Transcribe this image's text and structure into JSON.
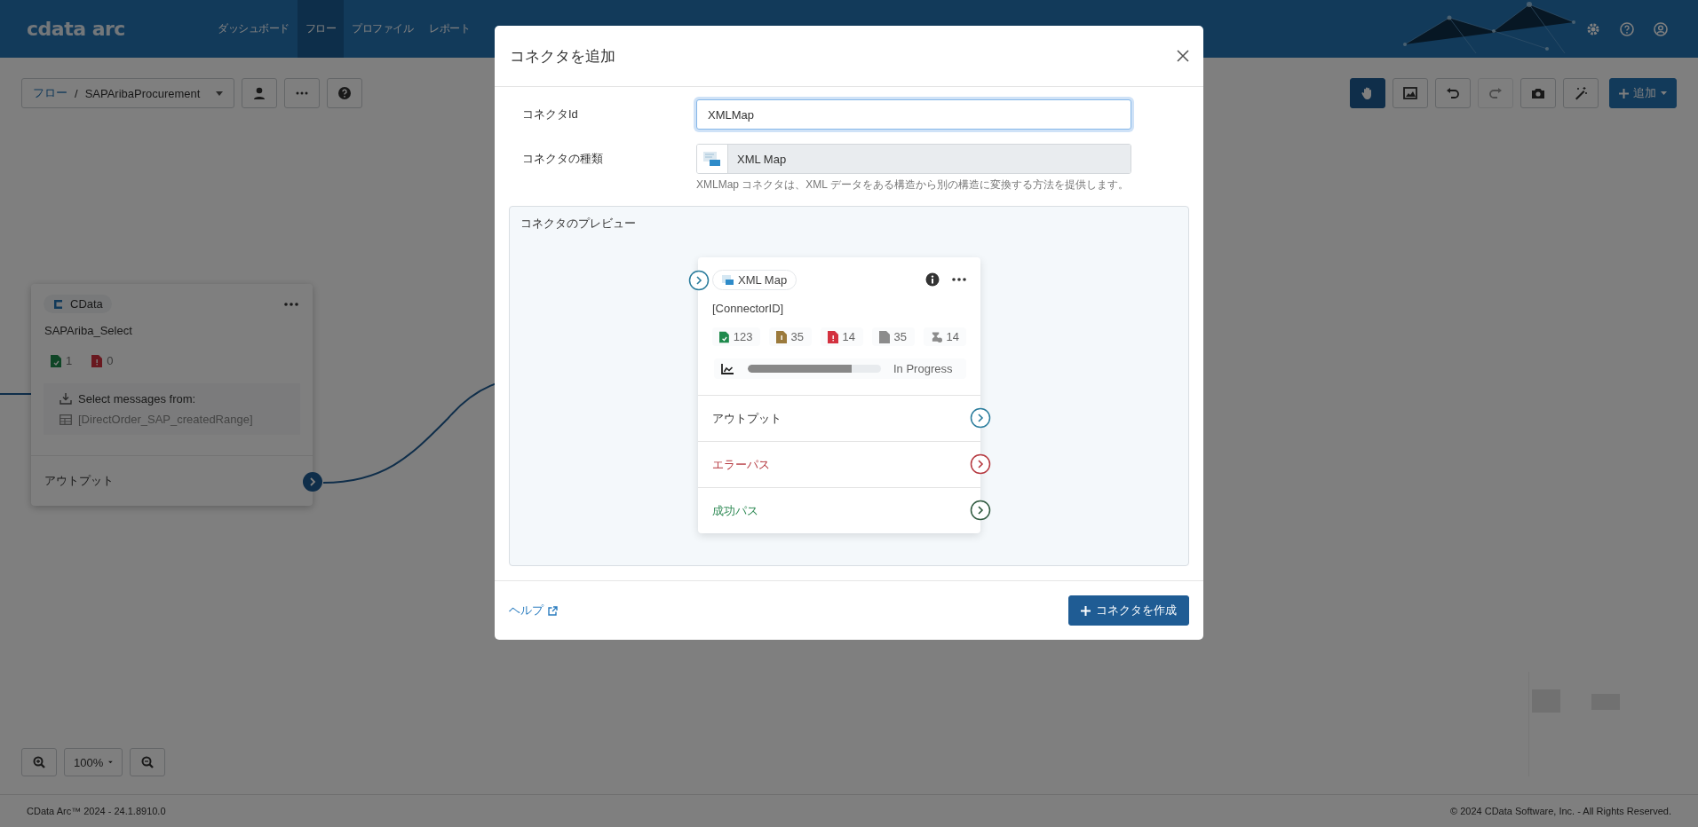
{
  "navbar": {
    "logo": "cdata arc",
    "nav_items": [
      {
        "label": "ダッシュボード",
        "selected": false
      },
      {
        "label": "フロー",
        "selected": true
      },
      {
        "label": "プロファイル",
        "selected": false
      },
      {
        "label": "レポート",
        "selected": false
      }
    ]
  },
  "toolbar": {
    "breadcrumb_root": "フロー",
    "breadcrumb_separator": "/",
    "breadcrumb_flow": "SAPAribaProcurement",
    "tools": [
      {
        "kind": "hand",
        "selected": true,
        "disabled": false
      },
      {
        "kind": "image",
        "selected": false,
        "disabled": false
      },
      {
        "kind": "undo",
        "selected": false,
        "disabled": false
      },
      {
        "kind": "redo",
        "selected": false,
        "disabled": true
      },
      {
        "kind": "camera",
        "selected": false,
        "disabled": false
      },
      {
        "kind": "magic",
        "selected": false,
        "disabled": false
      }
    ],
    "add_button": "追加"
  },
  "canvas_node": {
    "badge": "CData",
    "name": "SAPAriba_Select",
    "counts": [
      {
        "kind": "success",
        "value": "1"
      },
      {
        "kind": "error",
        "value": "0"
      }
    ],
    "select_label": "Select messages from:",
    "select_table": "[DirectOrder_SAP_createdRange]",
    "output": "アウトプット"
  },
  "zoom": {
    "level_label": "100%"
  },
  "footer": {
    "version": "CData Arc™ 2024 - 24.1.8910.0",
    "copyright": "© 2024 CData Software, Inc. - All Rights Reserved."
  },
  "modal": {
    "title": "コネクタを追加",
    "id_field": {
      "label": "コネクタId",
      "value": "XMLMap"
    },
    "type_field": {
      "label": "コネクタの種類",
      "value": "XML Map",
      "help": "XMLMap コネクタは、XML データをある構造から別の構造に変換する方法を提供します。"
    },
    "preview": {
      "title": "コネクタのプレビュー",
      "card": {
        "badge": "XML Map",
        "connector_id": "[ConnectorID]",
        "counts": [
          {
            "kind": "success",
            "value": "123"
          },
          {
            "kind": "warning",
            "value": "35"
          },
          {
            "kind": "error",
            "value": "14"
          },
          {
            "kind": "skipped",
            "value": "35"
          },
          {
            "kind": "pending",
            "value": "14"
          }
        ],
        "progress": {
          "level": 0.78,
          "label": "In Progress"
        },
        "ports": [
          {
            "kind": "output",
            "label": "アウトプット"
          },
          {
            "kind": "error",
            "label": "エラーパス"
          },
          {
            "kind": "success",
            "label": "成功パス"
          }
        ]
      }
    },
    "help_link": "ヘルプ",
    "create_button": "コネクタを作成"
  }
}
